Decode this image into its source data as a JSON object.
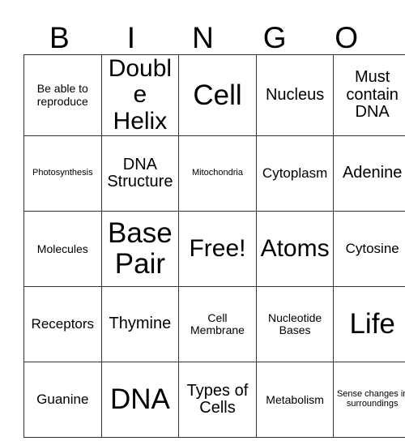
{
  "card": {
    "header_letters": [
      "B",
      "I",
      "N",
      "G",
      "O"
    ],
    "rows": [
      [
        {
          "text": "Be able to reproduce",
          "size": "xs"
        },
        {
          "text": "Double Helix",
          "size": "xl"
        },
        {
          "text": "Cell",
          "size": "xxl"
        },
        {
          "text": "Nucleus",
          "size": "md"
        },
        {
          "text": "Must contain DNA",
          "size": "md"
        }
      ],
      [
        {
          "text": "Photosynthesis",
          "size": "xxs"
        },
        {
          "text": "DNA Structure",
          "size": "md"
        },
        {
          "text": "Mitochondria",
          "size": "xxs"
        },
        {
          "text": "Cytoplasm",
          "size": "sm"
        },
        {
          "text": "Adenine",
          "size": "md"
        }
      ],
      [
        {
          "text": "Molecules",
          "size": "xs"
        },
        {
          "text": "Base Pair",
          "size": "xxl"
        },
        {
          "text": "Free!",
          "size": "xl"
        },
        {
          "text": "Atoms",
          "size": "xl"
        },
        {
          "text": "Cytosine",
          "size": "sm"
        }
      ],
      [
        {
          "text": "Receptors",
          "size": "sm"
        },
        {
          "text": "Thymine",
          "size": "md"
        },
        {
          "text": "Cell Membrane",
          "size": "xs"
        },
        {
          "text": "Nucleotide Bases",
          "size": "xs"
        },
        {
          "text": "Life",
          "size": "xxl"
        }
      ],
      [
        {
          "text": "Guanine",
          "size": "sm"
        },
        {
          "text": "DNA",
          "size": "xxl"
        },
        {
          "text": "Types of Cells",
          "size": "md"
        },
        {
          "text": "Metabolism",
          "size": "xs"
        },
        {
          "text": "Sense changes in surroundings",
          "size": "xxs"
        }
      ]
    ]
  },
  "colors": {
    "border": "#333333",
    "text": "#000000",
    "background": "#ffffff"
  }
}
